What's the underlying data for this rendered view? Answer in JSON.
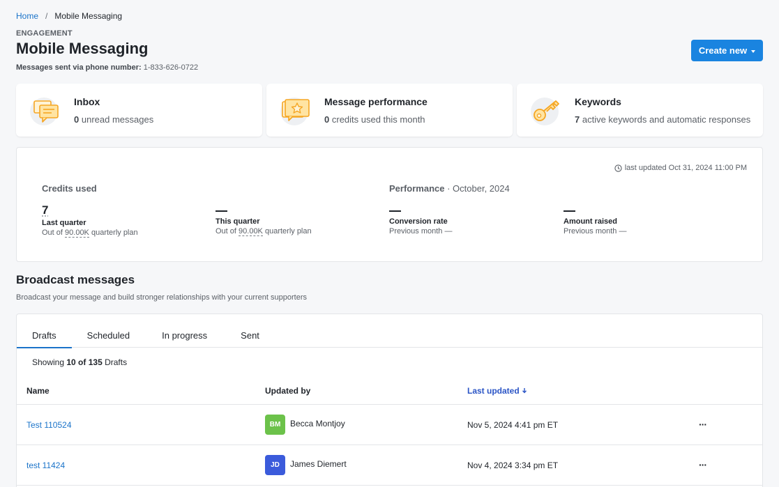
{
  "breadcrumb": {
    "home": "Home",
    "separator": "/",
    "current": "Mobile Messaging"
  },
  "header": {
    "overline": "ENGAGEMENT",
    "title": "Mobile Messaging",
    "subtitle_label": "Messages sent via phone number:",
    "subtitle_value": "1-833-626-0722",
    "create_button": "Create new"
  },
  "cards": [
    {
      "title": "Inbox",
      "count": "0",
      "desc": "unread messages",
      "icon": "chat-bubbles-icon"
    },
    {
      "title": "Message performance",
      "count": "0",
      "desc": "credits used this month",
      "icon": "star-message-icon"
    },
    {
      "title": "Keywords",
      "count": "7",
      "desc": "active keywords and automatic responses",
      "icon": "key-icon"
    }
  ],
  "stats": {
    "last_updated": "last updated Oct 31, 2024 11:00 PM",
    "credits_heading": "Credits used",
    "performance_heading": "Performance",
    "performance_period": " · October, 2024",
    "items": [
      {
        "value": "7",
        "label": "Last quarter",
        "sub_prefix": "Out of ",
        "sub_value": "90.00K",
        "sub_suffix": " quarterly plan"
      },
      {
        "value": "",
        "label": "This quarter",
        "sub_prefix": "Out of ",
        "sub_value": "90.00K",
        "sub_suffix": " quarterly plan"
      },
      {
        "value": "",
        "label": "Conversion rate",
        "sub_prefix": "Previous month —",
        "sub_value": "",
        "sub_suffix": ""
      },
      {
        "value": "",
        "label": "Amount raised",
        "sub_prefix": "Previous month —",
        "sub_value": "",
        "sub_suffix": ""
      }
    ]
  },
  "broadcast": {
    "title": "Broadcast messages",
    "subtitle": "Broadcast your message and build stronger relationships with your current supporters",
    "tabs": [
      "Drafts",
      "Scheduled",
      "In progress",
      "Sent"
    ],
    "showing_prefix": "Showing ",
    "showing_count": "10 of 135",
    "showing_suffix": " Drafts",
    "columns": {
      "name": "Name",
      "updated_by": "Updated by",
      "last_updated": "Last updated"
    },
    "rows": [
      {
        "name": "Test 110524",
        "initials": "BM",
        "user": "Becca Montjoy",
        "avatar_color": "#6cc24a",
        "date": "Nov 5, 2024 4:41 pm ET",
        "menu": "···"
      },
      {
        "name": "test 11424",
        "initials": "JD",
        "user": "James Diemert",
        "avatar_color": "#3b5bdb",
        "date": "Nov 4, 2024 3:34 pm ET",
        "menu": "···"
      }
    ]
  },
  "colors": {
    "accent": "#1a84e0",
    "link": "#1a73c9",
    "icon_orange": "#f5a623"
  }
}
